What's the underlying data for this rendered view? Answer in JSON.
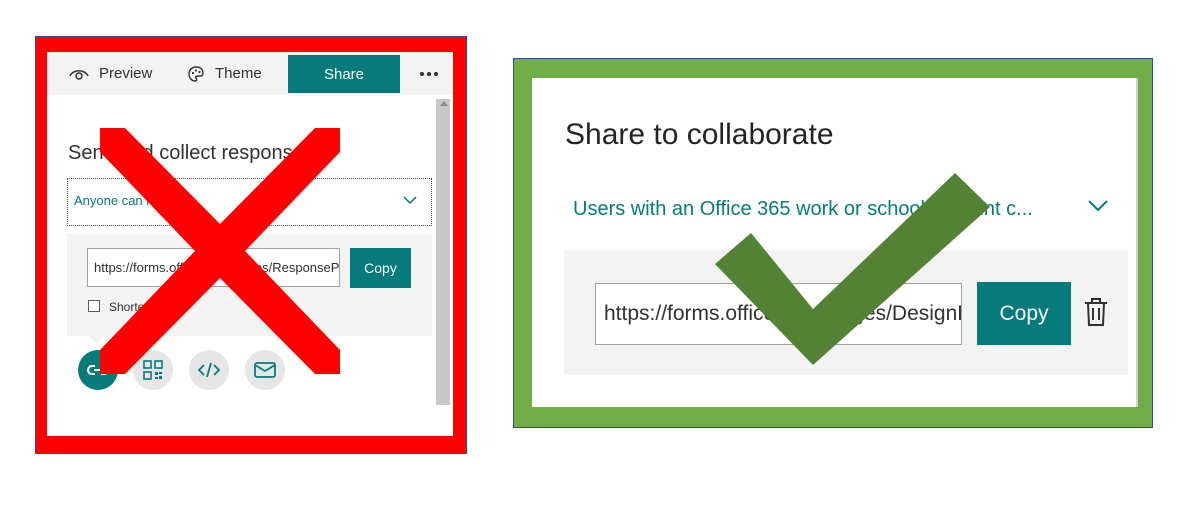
{
  "left_panel": {
    "toolbar": {
      "preview_label": "Preview",
      "theme_label": "Theme",
      "share_label": "Share",
      "more_icon": "more-ellipsis-icon"
    },
    "heading": "Send and collect responses",
    "dropdown_value": "Anyone can respond",
    "url_value": "https://forms.office.com/Pages/ResponsePage.aspx",
    "copy_label": "Copy",
    "shorten_url_label": "Shorten URL",
    "share_options": [
      "link-icon",
      "qr-code-icon",
      "embed-code-icon",
      "email-icon"
    ],
    "overlay_icon": "red-x-icon"
  },
  "right_panel": {
    "heading": "Share to collaborate",
    "dropdown_value": "Users with an Office 365 work or school account c...",
    "url_value": "https://forms.office.com/Pages/DesignPage.aspx",
    "copy_label": "Copy",
    "delete_icon": "trash-icon",
    "overlay_icon": "green-check-icon"
  },
  "colors": {
    "accent_teal": "#077a7c",
    "wrong_frame": "#ff0000",
    "right_frame": "#70ad47",
    "check_green": "#548235"
  }
}
